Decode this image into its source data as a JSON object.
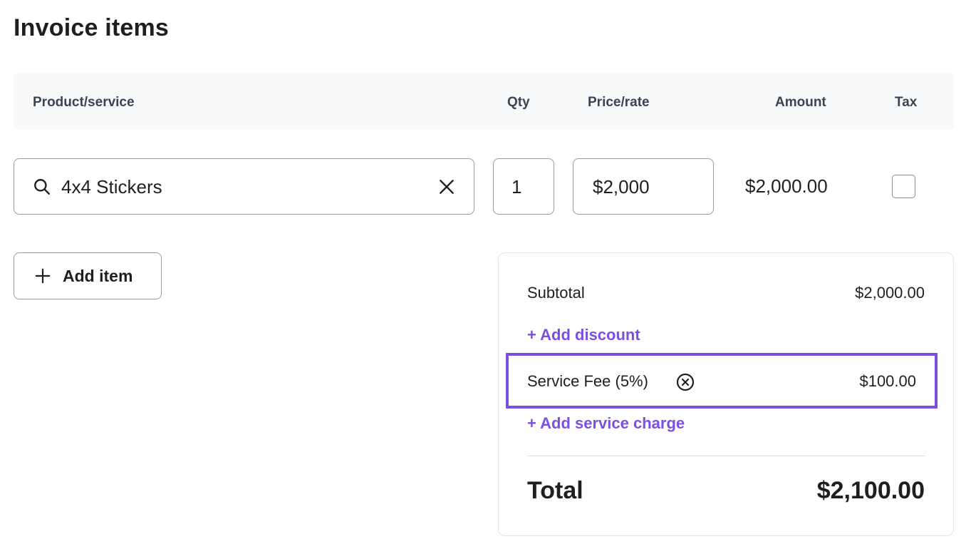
{
  "page": {
    "title": "Invoice items"
  },
  "table": {
    "headers": {
      "product": "Product/service",
      "qty": "Qty",
      "price": "Price/rate",
      "amount": "Amount",
      "tax": "Tax"
    },
    "rows": [
      {
        "product": "4x4 Stickers",
        "qty": "1",
        "price": "$2,000",
        "amount": "$2,000.00",
        "tax_checked": false
      }
    ]
  },
  "actions": {
    "add_item": "Add item"
  },
  "summary": {
    "subtotal_label": "Subtotal",
    "subtotal_value": "$2,000.00",
    "add_discount": "+ Add discount",
    "service_fee_label": "Service Fee (5%)",
    "service_fee_value": "$100.00",
    "add_service_charge": "+ Add service charge",
    "total_label": "Total",
    "total_value": "$2,100.00"
  },
  "colors": {
    "accent": "#7b4fe3",
    "header_bg": "#f8f9fb",
    "border": "#9a9a9a"
  },
  "icons": {
    "search": "search-icon",
    "clear": "close-icon",
    "plus": "plus-icon",
    "remove": "circle-x-icon"
  }
}
